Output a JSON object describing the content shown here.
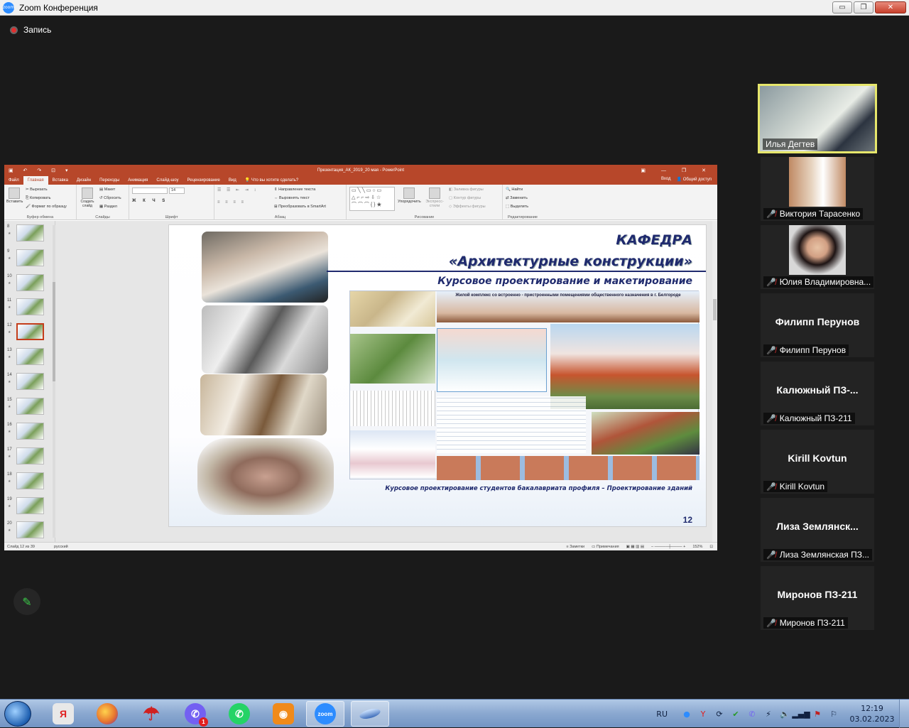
{
  "window": {
    "title": "Zoom Конференция",
    "minimize": "▭",
    "restore": "❐",
    "close": "✕"
  },
  "recording": {
    "label": "Запись"
  },
  "powerpoint": {
    "title": "Презентация_АК_2019_20 мая - PowerPoint",
    "tabs": [
      "Файл",
      "Главная",
      "Вставка",
      "Дизайн",
      "Переходы",
      "Анимация",
      "Слайд-шоу",
      "Рецензирование",
      "Вид"
    ],
    "active_tab": "Главная",
    "tell_me": "Что вы хотите сделать?",
    "signin": "Вход",
    "share": "Общий доступ",
    "ribbon": {
      "clipboard": {
        "paste": "Вставить",
        "cut": "Вырезать",
        "copy": "Копировать",
        "format_painter": "Формат по образцу",
        "name": "Буфер обмена"
      },
      "slides": {
        "new_slide": "Создать слайд",
        "layout": "Макет",
        "reset": "Сбросить",
        "section": "Раздел",
        "name": "Слайды"
      },
      "font": {
        "size": "14",
        "name": "Шрифт"
      },
      "paragraph": {
        "text_direction": "Направление текста",
        "align_text": "Выровнять текст",
        "smartart": "Преобразовать в SmartArt",
        "name": "Абзац"
      },
      "drawing": {
        "arrange": "Упорядочить",
        "quick_styles": "Экспресс-стили",
        "shape_fill": "Заливка фигуры",
        "shape_outline": "Контур фигуры",
        "shape_effects": "Эффекты фигуры",
        "name": "Рисование"
      },
      "editing": {
        "find": "Найти",
        "replace": "Заменить",
        "select": "Выделить",
        "name": "Редактирование"
      }
    },
    "thumbnails": [
      "8",
      "9",
      "10",
      "11",
      "12",
      "13",
      "14",
      "15",
      "16",
      "17",
      "18",
      "19",
      "20"
    ],
    "selected_slide": "12",
    "slide": {
      "title1": "КАФЕДРА",
      "title2": "«Архитектурные конструкции»",
      "subtitle": "Курсовое проектирование и макетирование",
      "poster_title": "Жилой комплекс со встроенно - пристроенными помещениями общественного назначения в г. Белгороде",
      "caption": "Курсовое проектирование студентов бакалавриата профиля – Проектирование зданий",
      "number": "12"
    },
    "status": {
      "slide_info": "Слайд 12 из 39",
      "language": "русский",
      "notes": "Заметки",
      "comments": "Примечания",
      "zoom": "152%"
    }
  },
  "participants": [
    {
      "name": "Илья Дегтев",
      "muted": false,
      "video": true,
      "active": true
    },
    {
      "name": "Виктория Тарасенко",
      "muted": true,
      "video": true,
      "active": false
    },
    {
      "name": "Юлия Владимировна...",
      "muted": true,
      "video": true,
      "active": false
    },
    {
      "display": "Филипп Перунов",
      "name": "Филипп Перунов",
      "muted": true,
      "video": false
    },
    {
      "display": "Калюжный  ПЗ-...",
      "name": "Калюжный ПЗ-211",
      "muted": true,
      "video": false
    },
    {
      "display": "Kirill Kovtun",
      "name": "Kirill Kovtun",
      "muted": true,
      "video": false
    },
    {
      "display": "Лиза  Землянск...",
      "name": "Лиза Землянская ПЗ...",
      "muted": true,
      "video": false
    },
    {
      "display": "Миронов ПЗ-211",
      "name": "Миронов ПЗ-211",
      "muted": true,
      "video": false
    }
  ],
  "taskbar": {
    "apps": [
      {
        "name": "yandex-browser",
        "label": "Я",
        "color": "#d8d8d8"
      },
      {
        "name": "firefox",
        "label": "",
        "color": "#e8772e"
      },
      {
        "name": "umbrella",
        "label": "",
        "color": "#d02020"
      },
      {
        "name": "viber",
        "label": "",
        "color": "#7360f2",
        "badge": "1"
      },
      {
        "name": "whatsapp",
        "label": "",
        "color": "#25d366"
      },
      {
        "name": "ok",
        "label": "",
        "color": "#f08a1a"
      },
      {
        "name": "zoom",
        "label": "zoom",
        "color": "#2d8cff"
      },
      {
        "name": "disc",
        "label": "",
        "color": "#4a7ac8"
      }
    ],
    "tray_lang": "RU",
    "time": "12:19",
    "date": "03.02.2023"
  }
}
